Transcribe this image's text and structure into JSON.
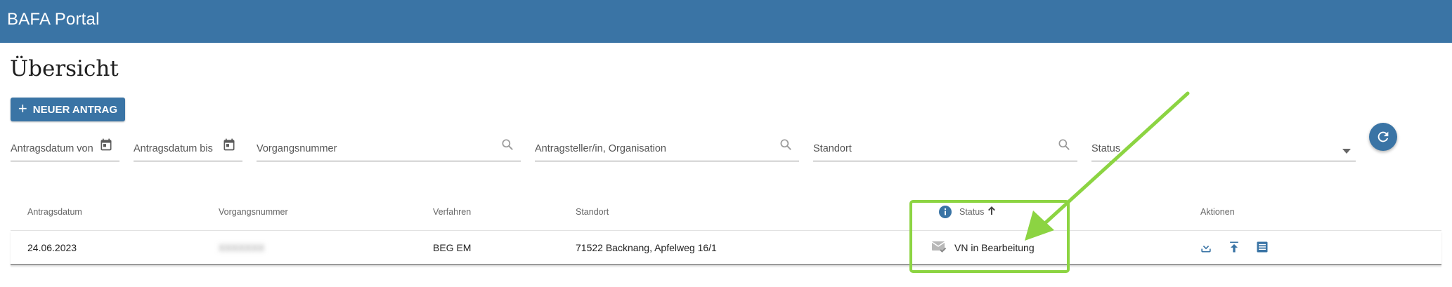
{
  "app": {
    "title": "BAFA Portal",
    "brand_color": "#3a74a5"
  },
  "page": {
    "title": "Übersicht"
  },
  "actions": {
    "new_application_label": "NEUER ANTRAG"
  },
  "filters": {
    "date_from": "Antragsdatum von",
    "date_to": "Antragsdatum bis",
    "case_number": "Vorgangsnummer",
    "applicant": "Antragsteller/in, Organisation",
    "location": "Standort",
    "status": "Status"
  },
  "table": {
    "columns": [
      "Antragsdatum",
      "Vorgangsnummer",
      "Verfahren",
      "Standort",
      "Status",
      "Aktionen"
    ],
    "sort": {
      "column": "Status",
      "direction": "ascending"
    },
    "rows": [
      {
        "date": "24.06.2023",
        "case_number": "XXXXXXX",
        "procedure": "BEG EM",
        "location": "71522 Backnang, Apfelweg 16/1",
        "status": "VN in Bearbeitung",
        "status_icon": "mail-check-icon"
      }
    ]
  },
  "annotation": {
    "color": "#8cd442"
  }
}
